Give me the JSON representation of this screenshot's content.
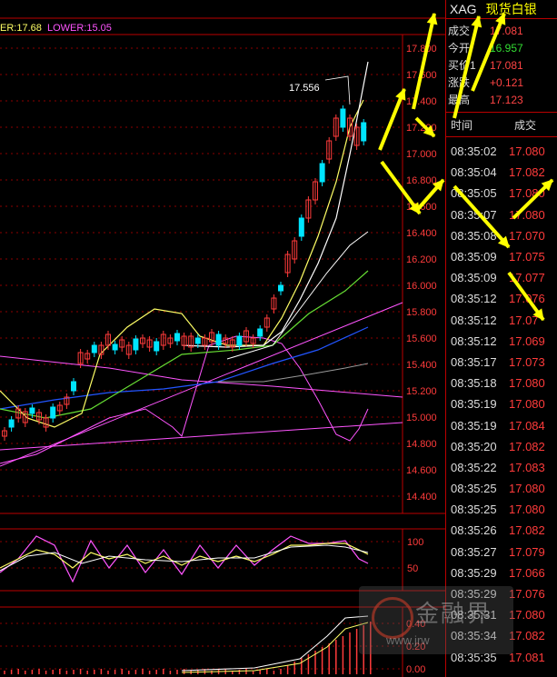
{
  "legend": {
    "upper": "ER:17.68",
    "lower": "LOWER:15.05"
  },
  "annotation": "17.556",
  "axis_main": [
    "17.800",
    "17.600",
    "17.400",
    "17.200",
    "17.000",
    "16.800",
    "16.600",
    "16.400",
    "16.200",
    "16.000",
    "15.800",
    "15.600",
    "15.400",
    "15.200",
    "15.000",
    "14.800",
    "14.600",
    "14.400"
  ],
  "axis_mid": [
    "100",
    "50"
  ],
  "axis_bot": [
    "0.40",
    "0.20",
    "0.00"
  ],
  "panel": {
    "symbol": "XAG",
    "name": "现货白银",
    "stats": [
      {
        "label": "成交",
        "value": "17.081"
      },
      {
        "label": "今开",
        "value": "16.957"
      },
      {
        "label": "买价1",
        "value": "17.081"
      },
      {
        "label": "涨跌",
        "value": "+0.121"
      },
      {
        "label": "最高",
        "value": "17.123"
      }
    ],
    "table_header": {
      "time": "时间",
      "price": "成交"
    },
    "trades": [
      {
        "time": "08:35:02",
        "price": "17.080"
      },
      {
        "time": "08:35:04",
        "price": "17.082"
      },
      {
        "time": "08:35:05",
        "price": "17.080"
      },
      {
        "time": "08:35:07",
        "price": "17.080"
      },
      {
        "time": "08:35:08",
        "price": "17.070"
      },
      {
        "time": "08:35:09",
        "price": "17.075"
      },
      {
        "time": "08:35:09",
        "price": "17.077"
      },
      {
        "time": "08:35:12",
        "price": "17.076"
      },
      {
        "time": "08:35:12",
        "price": "17.07"
      },
      {
        "time": "08:35:12",
        "price": "17.069"
      },
      {
        "time": "08:35:17",
        "price": "17.073"
      },
      {
        "time": "08:35:18",
        "price": "17.080"
      },
      {
        "time": "08:35:19",
        "price": "17.080"
      },
      {
        "time": "08:35:19",
        "price": "17.084"
      },
      {
        "time": "08:35:20",
        "price": "17.082"
      },
      {
        "time": "08:35:22",
        "price": "17.083"
      },
      {
        "time": "08:35:25",
        "price": "17.080"
      },
      {
        "time": "08:35:25",
        "price": "17.080"
      },
      {
        "time": "08:35:26",
        "price": "17.082"
      },
      {
        "time": "08:35:27",
        "price": "17.079"
      },
      {
        "time": "08:35:29",
        "price": "17.066"
      },
      {
        "time": "08:35:29",
        "price": "17.076"
      },
      {
        "time": "08:35:31",
        "price": "17.080"
      },
      {
        "time": "08:35:34",
        "price": "17.082"
      },
      {
        "time": "08:35:35",
        "price": "17.081"
      }
    ]
  },
  "watermark": {
    "text": "金融界",
    "url": "www.jrw"
  },
  "colors": {
    "up": "#ff3b3b",
    "down": "#00e5ff",
    "ma1": "#ffffff",
    "ma2": "#ffff66",
    "ma3": "#66dd33",
    "ma4": "#2255ff",
    "boll": "#ff55ff",
    "arrow": "#ffff00"
  }
}
